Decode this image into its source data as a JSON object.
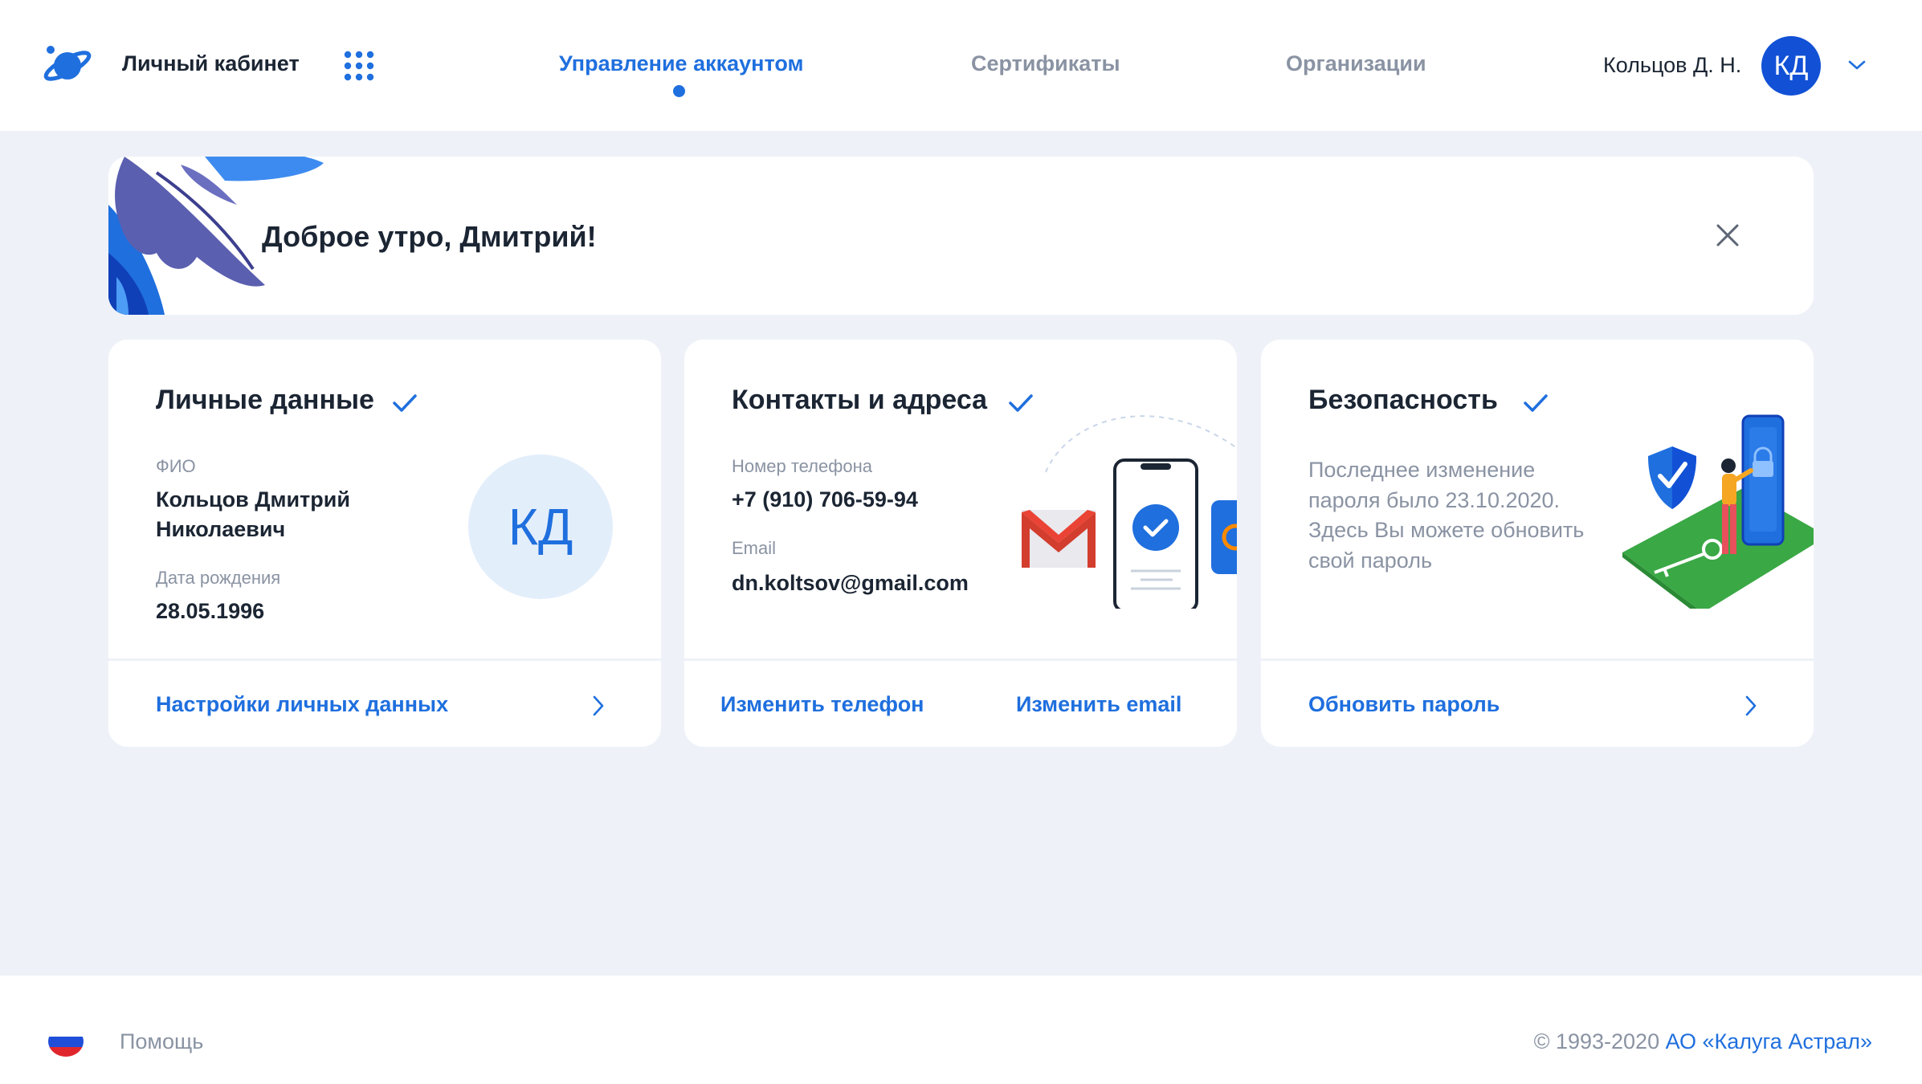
{
  "header": {
    "app_title": "Личный кабинет",
    "apps_icon": "grid-icon",
    "tabs": [
      {
        "label": "Управление аккаунтом",
        "active": true
      },
      {
        "label": "Сертификаты",
        "active": false
      },
      {
        "label": "Организации",
        "active": false
      }
    ],
    "user_name": "Кольцов Д. Н.",
    "avatar_initials": "КД"
  },
  "banner": {
    "greeting": "Доброе утро, Дмитрий!",
    "close_icon": "close-icon"
  },
  "cards": {
    "personal": {
      "title": "Личные данные",
      "fio_label": "ФИО",
      "fio_line1": "Кольцов Дмитрий",
      "fio_line2": "Николаевич",
      "birth_label": "Дата рождения",
      "birth_value": "28.05.1996",
      "avatar_initials": "КД",
      "link": "Настройки личных данных"
    },
    "contacts": {
      "title": "Контакты и адреса",
      "phone_label": "Номер телефона",
      "phone_value": "+7 (910) 706-59-94",
      "email_label": "Email",
      "email_value": "dn.koltsov@gmail.com",
      "link_phone": "Изменить телефон",
      "link_email": "Изменить email"
    },
    "security": {
      "title": "Безопасность",
      "text": "Последнее изменение пароля было 23.10.2020. Здесь Вы можете обновить свой пароль",
      "link": "Обновить пароль"
    }
  },
  "footer": {
    "help": "Помощь",
    "copyright": "© 1993-2020",
    "company": "АО «Калуга Астрал»"
  },
  "colors": {
    "accent": "#1f6fde",
    "avatar_bg": "#1251d6",
    "page_bg": "#eef2f8",
    "muted_text": "#8a93a3"
  }
}
